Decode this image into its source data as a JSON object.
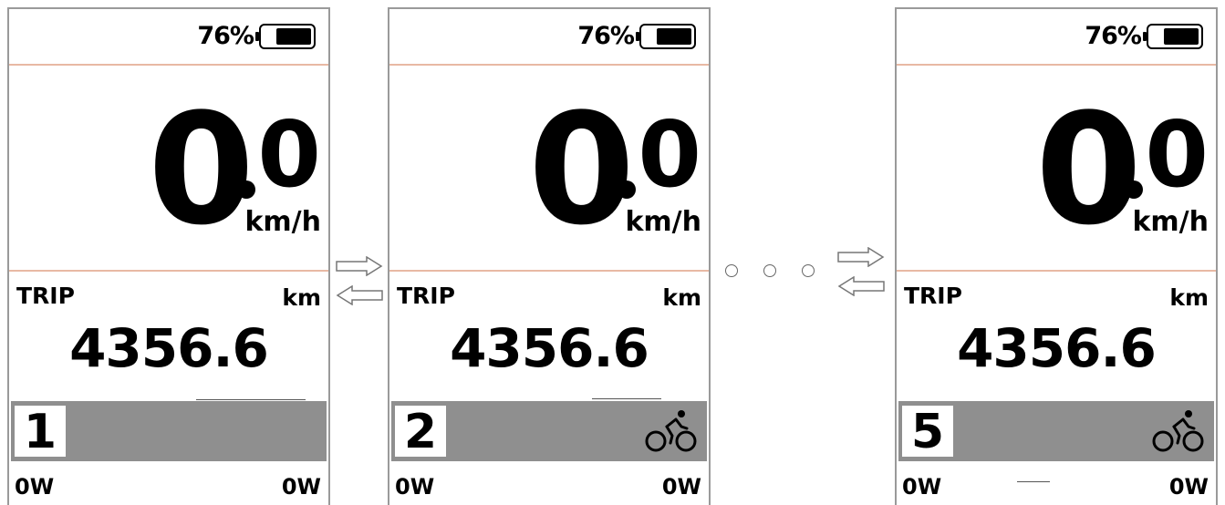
{
  "screens": [
    {
      "battery": {
        "label": "76%",
        "level": 0.76
      },
      "speed": {
        "int": "0",
        "dec": "0",
        "unit": "km/h"
      },
      "trip": {
        "label": "TRIP",
        "unit": "km",
        "value": "4356.6"
      },
      "assist_level": "1",
      "show_bike_icon": false,
      "power": {
        "left": "0W",
        "right": "0W"
      }
    },
    {
      "battery": {
        "label": "76%",
        "level": 0.76
      },
      "speed": {
        "int": "0",
        "dec": "0",
        "unit": "km/h"
      },
      "trip": {
        "label": "TRIP",
        "unit": "km",
        "value": "4356.6"
      },
      "assist_level": "2",
      "show_bike_icon": true,
      "power": {
        "left": "0W",
        "right": "0W"
      }
    },
    {
      "battery": {
        "label": "76%",
        "level": 0.76
      },
      "speed": {
        "int": "0",
        "dec": "0",
        "unit": "km/h"
      },
      "trip": {
        "label": "TRIP",
        "unit": "km",
        "value": "4356.6"
      },
      "assist_level": "5",
      "show_bike_icon": true,
      "power": {
        "left": "0W",
        "right": "0W"
      }
    }
  ],
  "icons": {
    "battery": "battery-icon",
    "bike": "bicycle-icon",
    "arrow_right": "arrow-right-icon",
    "arrow_left": "arrow-left-icon",
    "ellipsis": "ellipsis-dots-icon"
  },
  "colors": {
    "divider": "#e8b9a4",
    "assist_bar": "#8f8f8f",
    "border": "#9a9a9a"
  }
}
